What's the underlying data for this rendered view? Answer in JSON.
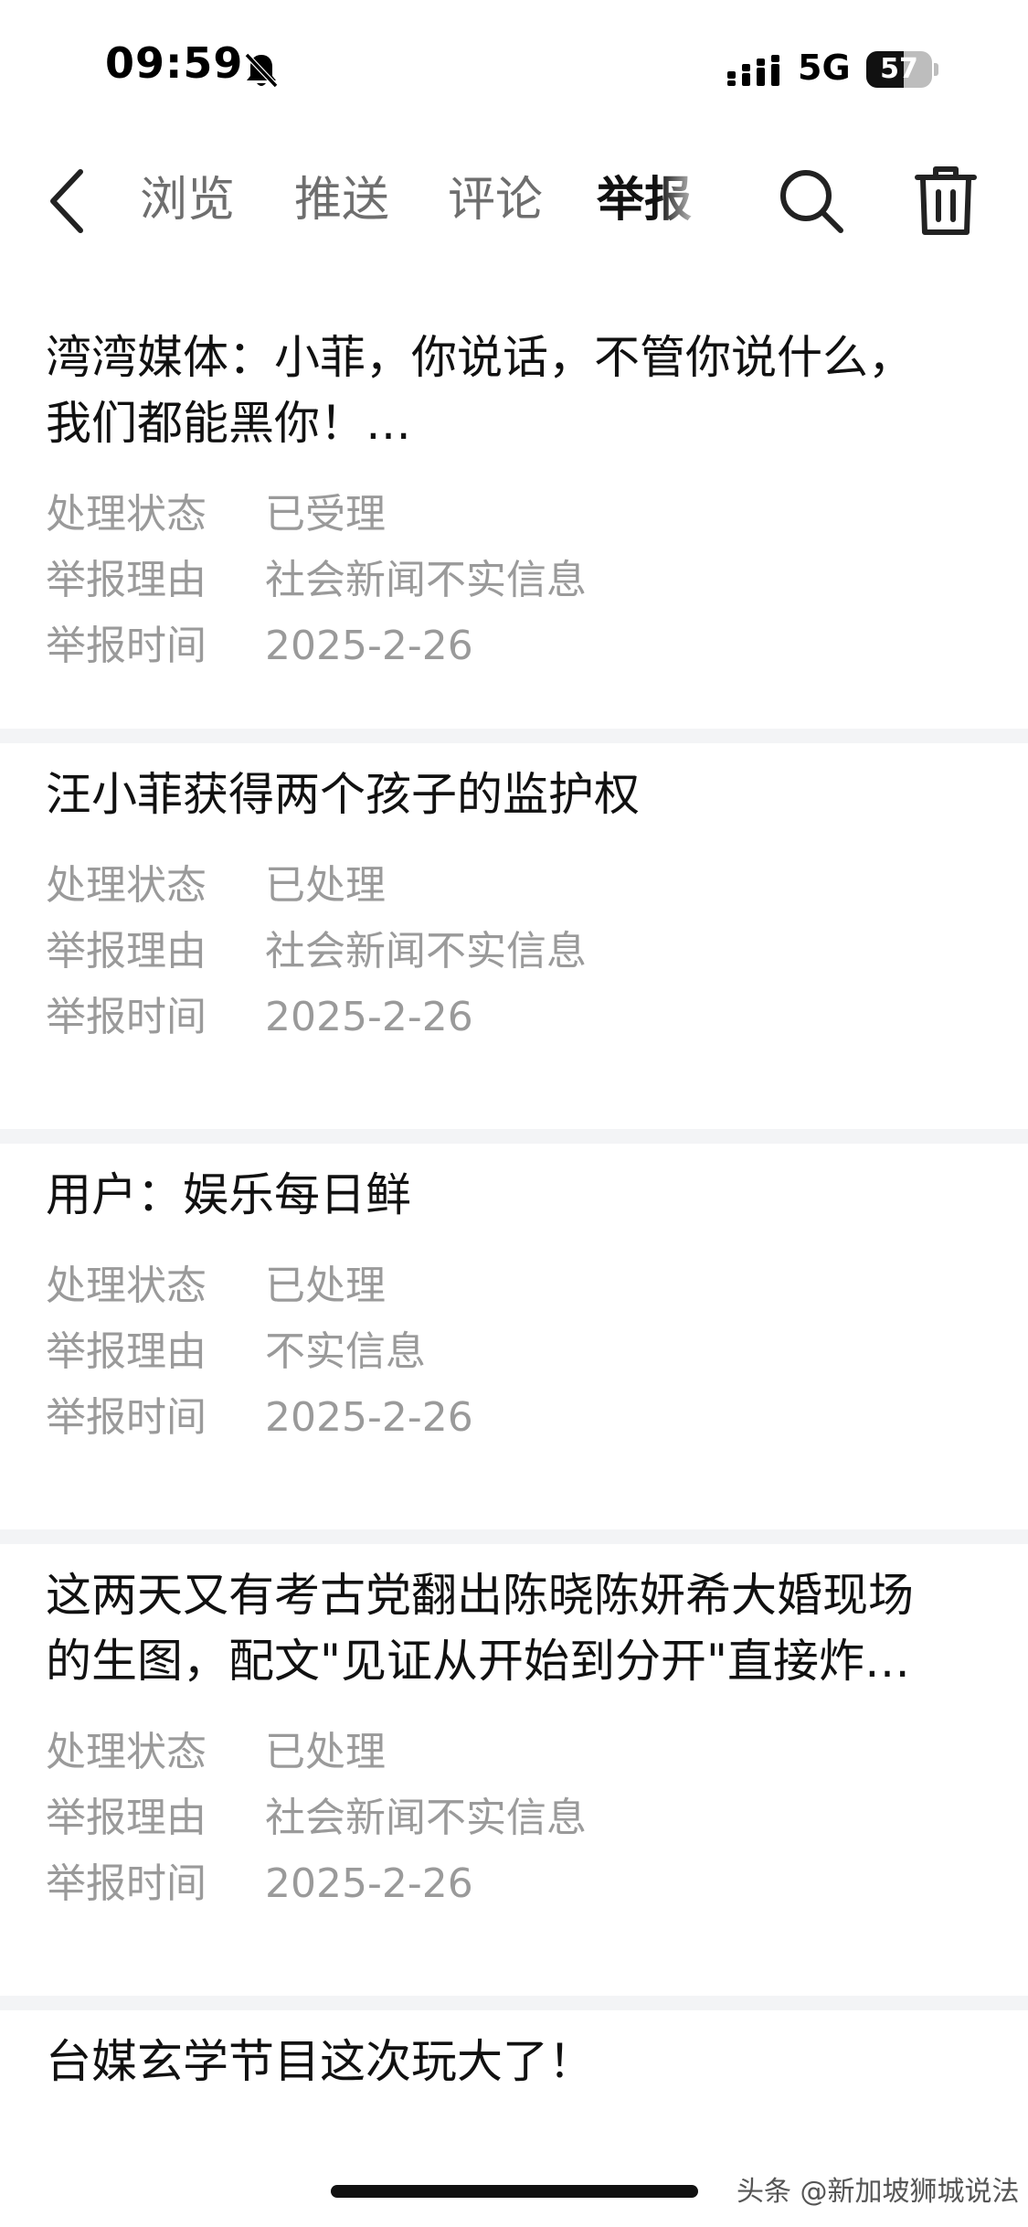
{
  "status_bar": {
    "time": "09:59",
    "network": "5G",
    "battery_level": "57",
    "battery_fraction": 0.57
  },
  "nav": {
    "tabs": [
      {
        "label": "浏览",
        "active": false
      },
      {
        "label": "推送",
        "active": false
      },
      {
        "label": "评论",
        "active": false
      },
      {
        "label": "举报",
        "active": true
      }
    ],
    "icons": [
      "back-icon",
      "search-icon",
      "trash-icon"
    ]
  },
  "labels": {
    "status": "处理状态",
    "reason": "举报理由",
    "time": "举报时间"
  },
  "reports": [
    {
      "title_lines": [
        "湾湾媒体：小菲，你说话，不管你说什么，",
        "我们都能黑你！…"
      ],
      "status": "已受理",
      "reason": "社会新闻不实信息",
      "date": "2025-2-26"
    },
    {
      "title_lines": [
        "汪小菲获得两个孩子的监护权"
      ],
      "status": "已处理",
      "reason": "社会新闻不实信息",
      "date": "2025-2-26"
    },
    {
      "title_lines": [
        "用户：娱乐每日鲜"
      ],
      "status": "已处理",
      "reason": "不实信息",
      "date": "2025-2-26"
    },
    {
      "title_lines": [
        "这两天又有考古党翻出陈晓陈妍希大婚现场",
        "的生图，配文\"见证从开始到分开\"直接炸…"
      ],
      "status": "已处理",
      "reason": "社会新闻不实信息",
      "date": "2025-2-26"
    },
    {
      "title_lines": [
        "台媒玄学节目这次玩大了！"
      ]
    }
  ],
  "watermark": "头条 @新加坡狮城说法"
}
